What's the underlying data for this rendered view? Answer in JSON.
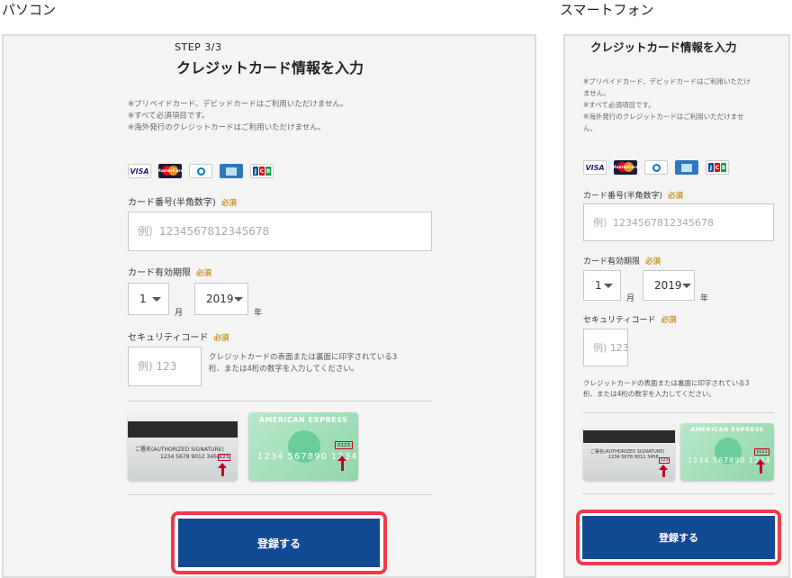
{
  "labels": {
    "pc": "パソコン",
    "sp": "スマートフォン"
  },
  "form": {
    "step": "STEP 3/3",
    "title": "クレジットカード情報を入力",
    "notes": [
      "※プリペイドカード、デビッドカードはご利用いただけません。",
      "※すべて必須項目です。",
      "※海外発行のクレジットカードはご利用いただけません。"
    ],
    "sp_notes": [
      "※プリペイドカード、デビッドカードはご利用いただけ",
      "ません。",
      "※すべて必須項目です。",
      "※海外発行のクレジットカードはご利用いただけませ",
      "ん。"
    ],
    "brands": {
      "visa": "VISA",
      "master": "MasterCard",
      "jcb": [
        "J",
        "C",
        "B"
      ]
    },
    "card_number_label": "カード番号(半角数字)",
    "required": "必須",
    "card_number_placeholder": "例）1234567812345678",
    "expiry_label": "カード有効期限",
    "month_value": "1",
    "month_unit": "月",
    "year_value": "2019",
    "year_unit": "年",
    "security_label": "セキュリティコード",
    "security_placeholder": "例) 123",
    "security_help_pc": [
      "クレジットカードの表面または裏面に印字されている3",
      "桁、または4桁の数字を入力してください。"
    ],
    "security_help_sp": [
      "クレジットカードの表面または裏面に印字されている3",
      "桁、または4桁の数字を入力してください。"
    ],
    "back_card": {
      "sig": "ご署名(AUTHORIZED SIGNATURE)",
      "digits": "1234 5678 9012 3456",
      "code": "123"
    },
    "amex_card": {
      "brand": "AMERICAN EXPRESS",
      "number": "1234  567890  1234",
      "code": "0123"
    },
    "submit": "登録する"
  },
  "colors": {
    "button": "#134a94",
    "highlight": "#ee3a4a",
    "required": "#c8962e"
  }
}
